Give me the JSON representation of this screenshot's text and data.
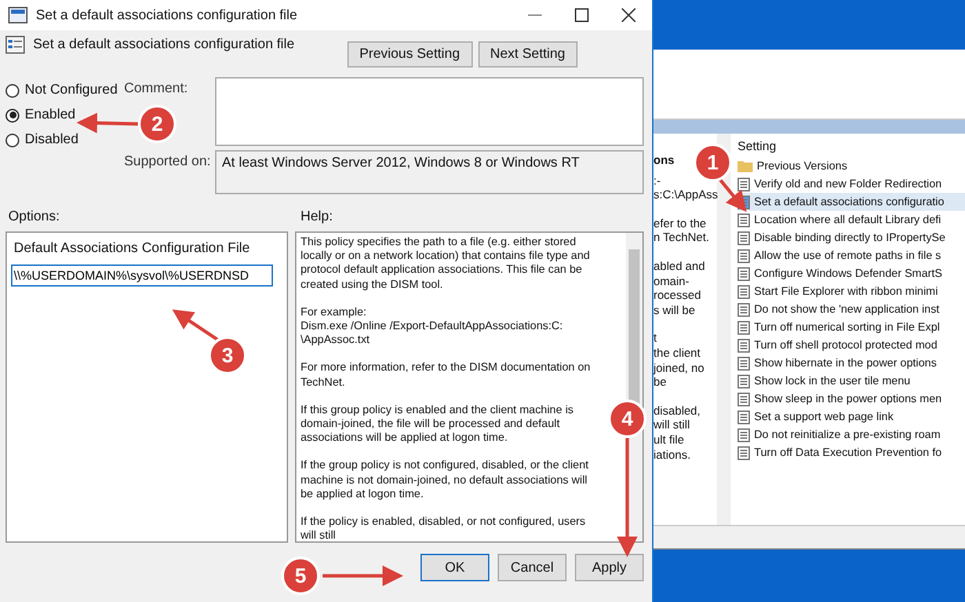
{
  "window": {
    "title": "Set a default associations configuration file"
  },
  "header": {
    "title": "Set a default associations configuration file",
    "buttons": [
      "Previous Setting",
      "Next Setting"
    ]
  },
  "state_options": [
    {
      "label": "Not Configured",
      "selected": false
    },
    {
      "label": "Enabled",
      "selected": true
    },
    {
      "label": "Disabled",
      "selected": false
    }
  ],
  "comment": {
    "label": "Comment:"
  },
  "supported_on": {
    "label": "Supported on:",
    "value": "At least Windows Server 2012, Windows 8 or Windows RT"
  },
  "options": {
    "label": "Options:",
    "field_label": "Default Associations Configuration File",
    "value": "\\\\%USERDOMAIN%\\sysvol\\%USERDNSD"
  },
  "help": {
    "label": "Help:",
    "paragraphs": [
      "This policy specifies the path to a file (e.g. either stored locally or on a network location) that contains file type and protocol default application associations. This file can be created using the DISM tool.",
      "For example:\nDism.exe /Online /Export-DefaultAppAssociations:C:\n\\AppAssoc.txt",
      "For more information, refer to the DISM documentation on TechNet.",
      "If this group policy is enabled and the client machine is domain-joined, the file will be processed and default associations will be applied at logon time.",
      "If the group policy is not configured, disabled, or the client machine is not domain-joined, no default associations will be applied at logon time.",
      "If the policy is enabled, disabled, or not configured, users will still"
    ]
  },
  "buttons": [
    "OK",
    "Cancel",
    "Apply"
  ],
  "background_window": {
    "help_fragments": [
      "ons",
      ":-",
      "s:C:\\AppAss",
      "efer to the",
      "n TechNet.",
      "abled and",
      "omain-",
      "rocessed",
      "s will be",
      "t",
      "the client",
      "joined, no",
      "be",
      "disabled,",
      "will still",
      "ult file",
      "iations."
    ],
    "list_header": "Setting",
    "items": [
      {
        "kind": "folder",
        "label": "Previous Versions",
        "selected": false
      },
      {
        "kind": "setting",
        "label": "Verify old and new Folder Redirection",
        "selected": false
      },
      {
        "kind": "setting",
        "label": "Set a default associations configuratio",
        "selected": true
      },
      {
        "kind": "setting",
        "label": "Location where all default Library defi",
        "selected": false
      },
      {
        "kind": "setting",
        "label": "Disable binding directly to IPropertySe",
        "selected": false
      },
      {
        "kind": "setting",
        "label": "Allow the use of remote paths in file s",
        "selected": false
      },
      {
        "kind": "setting",
        "label": "Configure Windows Defender SmartS",
        "selected": false
      },
      {
        "kind": "setting",
        "label": "Start File Explorer with ribbon minimi",
        "selected": false
      },
      {
        "kind": "setting",
        "label": "Do not show the 'new application inst",
        "selected": false
      },
      {
        "kind": "setting",
        "label": "Turn off numerical sorting in File Expl",
        "selected": false
      },
      {
        "kind": "setting",
        "label": "Turn off shell protocol protected mod",
        "selected": false
      },
      {
        "kind": "setting",
        "label": "Show hibernate in the power options",
        "selected": false
      },
      {
        "kind": "setting",
        "label": "Show lock in the user tile menu",
        "selected": false
      },
      {
        "kind": "setting",
        "label": "Show sleep in the power options men",
        "selected": false
      },
      {
        "kind": "setting",
        "label": "Set a support web page link",
        "selected": false
      },
      {
        "kind": "setting",
        "label": "Do not reinitialize a pre-existing roam",
        "selected": false
      },
      {
        "kind": "setting",
        "label": "Turn off Data Execution Prevention fo",
        "selected": false
      }
    ]
  },
  "annotations": [
    "1",
    "2",
    "3",
    "4",
    "5"
  ]
}
